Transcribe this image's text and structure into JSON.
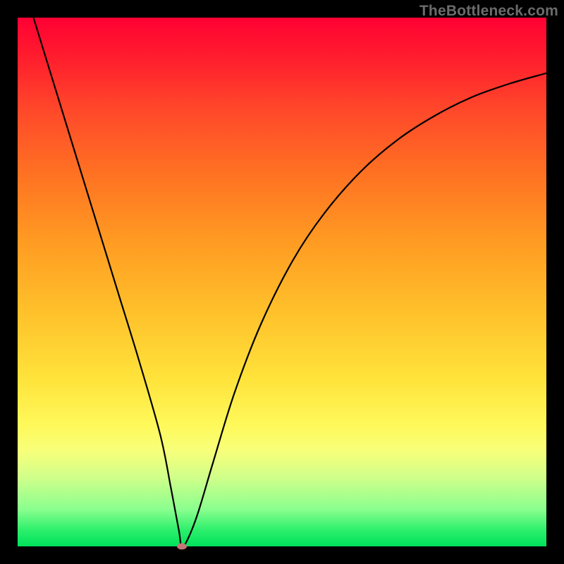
{
  "watermark": "TheBottleneck.com",
  "chart_data": {
    "type": "line",
    "title": "",
    "xlabel": "",
    "ylabel": "",
    "xlim": [
      0,
      100
    ],
    "ylim": [
      0,
      100
    ],
    "grid": false,
    "series": [
      {
        "name": "curve",
        "x": [
          3,
          7,
          11,
          15,
          19,
          23,
          27,
          29,
          30.5,
          31,
          32,
          34,
          37,
          41,
          46,
          52,
          58,
          65,
          72,
          79,
          86,
          93,
          100
        ],
        "values": [
          100,
          87,
          74,
          61,
          48,
          35,
          21,
          11,
          3,
          0,
          1,
          6,
          16,
          29,
          42,
          54,
          63,
          71,
          77,
          81.5,
          85,
          87.5,
          89.5
        ]
      }
    ],
    "minimum_point": {
      "x": 31,
      "y": 0
    },
    "gradient_stops": [
      {
        "pos": 0,
        "color": "#ff0033"
      },
      {
        "pos": 8,
        "color": "#ff1f2d"
      },
      {
        "pos": 18,
        "color": "#ff4a2a"
      },
      {
        "pos": 30,
        "color": "#ff7322"
      },
      {
        "pos": 42,
        "color": "#ff9a22"
      },
      {
        "pos": 55,
        "color": "#ffbf2a"
      },
      {
        "pos": 68,
        "color": "#ffe23a"
      },
      {
        "pos": 77,
        "color": "#fff95a"
      },
      {
        "pos": 82,
        "color": "#f7ff7a"
      },
      {
        "pos": 87,
        "color": "#d0ff8a"
      },
      {
        "pos": 93,
        "color": "#8aff8f"
      },
      {
        "pos": 97,
        "color": "#2bef6b"
      },
      {
        "pos": 100,
        "color": "#00e25b"
      }
    ]
  }
}
